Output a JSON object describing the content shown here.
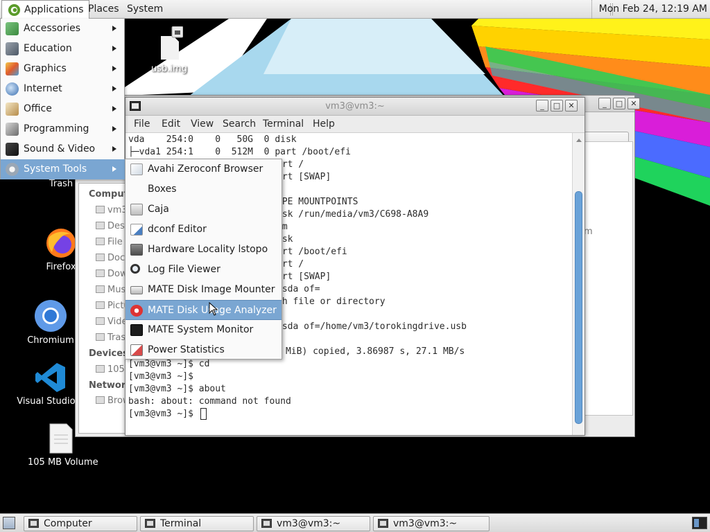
{
  "top_panel": {
    "applications_label": "Applications",
    "places_label": "Places",
    "system_label": "System",
    "clock": "Mon Feb 24, 12:19 AM"
  },
  "desktop": {
    "icons": [
      {
        "label": "usb.img",
        "icon": "file-locked-icon"
      },
      {
        "label": "Trash",
        "icon": "trash-icon"
      },
      {
        "label": "Firefox",
        "icon": "firefox-icon"
      },
      {
        "label": "Chromium",
        "icon": "chromium-icon"
      },
      {
        "label": "Visual Studio C",
        "icon": "vscode-icon"
      },
      {
        "label": "105 MB Volume",
        "icon": "volume-icon"
      }
    ]
  },
  "applications_menu": {
    "items": [
      {
        "label": "Accessories",
        "icon": "accessories-icon"
      },
      {
        "label": "Education",
        "icon": "education-icon"
      },
      {
        "label": "Graphics",
        "icon": "graphics-icon"
      },
      {
        "label": "Internet",
        "icon": "internet-icon"
      },
      {
        "label": "Office",
        "icon": "office-icon"
      },
      {
        "label": "Programming",
        "icon": "programming-icon"
      },
      {
        "label": "Sound & Video",
        "icon": "sound-video-icon"
      },
      {
        "label": "System Tools",
        "icon": "system-tools-icon",
        "selected": true
      }
    ]
  },
  "system_tools_submenu": {
    "items": [
      {
        "label": "Avahi Zeroconf Browser",
        "icon": "avahi-icon"
      },
      {
        "label": "Boxes",
        "icon": "boxes-icon"
      },
      {
        "label": "Caja",
        "icon": "caja-icon"
      },
      {
        "label": "dconf Editor",
        "icon": "dconf-icon"
      },
      {
        "label": "Hardware Locality lstopo",
        "icon": "lstopo-icon"
      },
      {
        "label": "Log File Viewer",
        "icon": "log-viewer-icon"
      },
      {
        "label": "MATE Disk Image Mounter",
        "icon": "disk-mounter-icon"
      },
      {
        "label": "MATE Disk Usage Analyzer",
        "icon": "disk-usage-icon",
        "selected": true
      },
      {
        "label": "MATE System Monitor",
        "icon": "system-monitor-icon"
      },
      {
        "label": "Power Statistics",
        "icon": "power-statistics-icon"
      }
    ]
  },
  "background_window": {
    "sidebar": {
      "headings": [
        "Comput",
        "Devices",
        "Network"
      ],
      "items": [
        "vm3",
        "Desk",
        "File S",
        "Docu",
        "Dow",
        "Musi",
        "Pictu",
        "Vide",
        "Tras",
        "105 M",
        "Brow"
      ]
    },
    "content_label": "em"
  },
  "terminal": {
    "title": "vm3@vm3:~",
    "menu": [
      "File",
      "Edit",
      "View",
      "Search",
      "Terminal",
      "Help"
    ],
    "lines": [
      "vda    254:0    0   50G  0 disk",
      "├─vda1 254:1    0  512M  0 part /boot/efi",
      "",
      "",
      "",
      "",
      "",
      "",
      "",
      "",
      "",
      "",
      "",
      "",
      "",
      "",
      "",
      "104857600 bytes (105 MB, 100 MiB) copied, 3.86987 s, 27.1 MB/s",
      "[vm3@vm3 ~]$ cd",
      "[vm3@vm3 ~]$",
      "[vm3@vm3 ~]$ about",
      "bash: about: command not found",
      "[vm3@vm3 ~]$ "
    ],
    "partial_lines": [
      {
        "row": 2,
        "text": "art /"
      },
      {
        "row": 3,
        "text": "art [SWAP]"
      },
      {
        "row": 5,
        "text": "YPE MOUNTPOINTS"
      },
      {
        "row": 6,
        "text": "isk /run/media/vm3/C698-A8A9"
      },
      {
        "row": 7,
        "text": "om"
      },
      {
        "row": 8,
        "text": "isk"
      },
      {
        "row": 9,
        "text": "art /boot/efi"
      },
      {
        "row": 10,
        "text": "art /"
      },
      {
        "row": 11,
        "text": "art [SWAP]"
      },
      {
        "row": 12,
        "text": "/sda of="
      },
      {
        "row": 13,
        "text": "ch file or directory"
      },
      {
        "row": 15,
        "text": "/sda of=/home/vm3/torokingdrive.usb"
      }
    ]
  },
  "taskbar": {
    "tasks": [
      {
        "label": "Computer"
      },
      {
        "label": "Terminal"
      },
      {
        "label": "vm3@vm3:~"
      },
      {
        "label": "vm3@vm3:~"
      }
    ]
  },
  "colors": {
    "menu_highlight": "#7aa6d2",
    "scrollbar_thumb": "#6aa2d8"
  }
}
